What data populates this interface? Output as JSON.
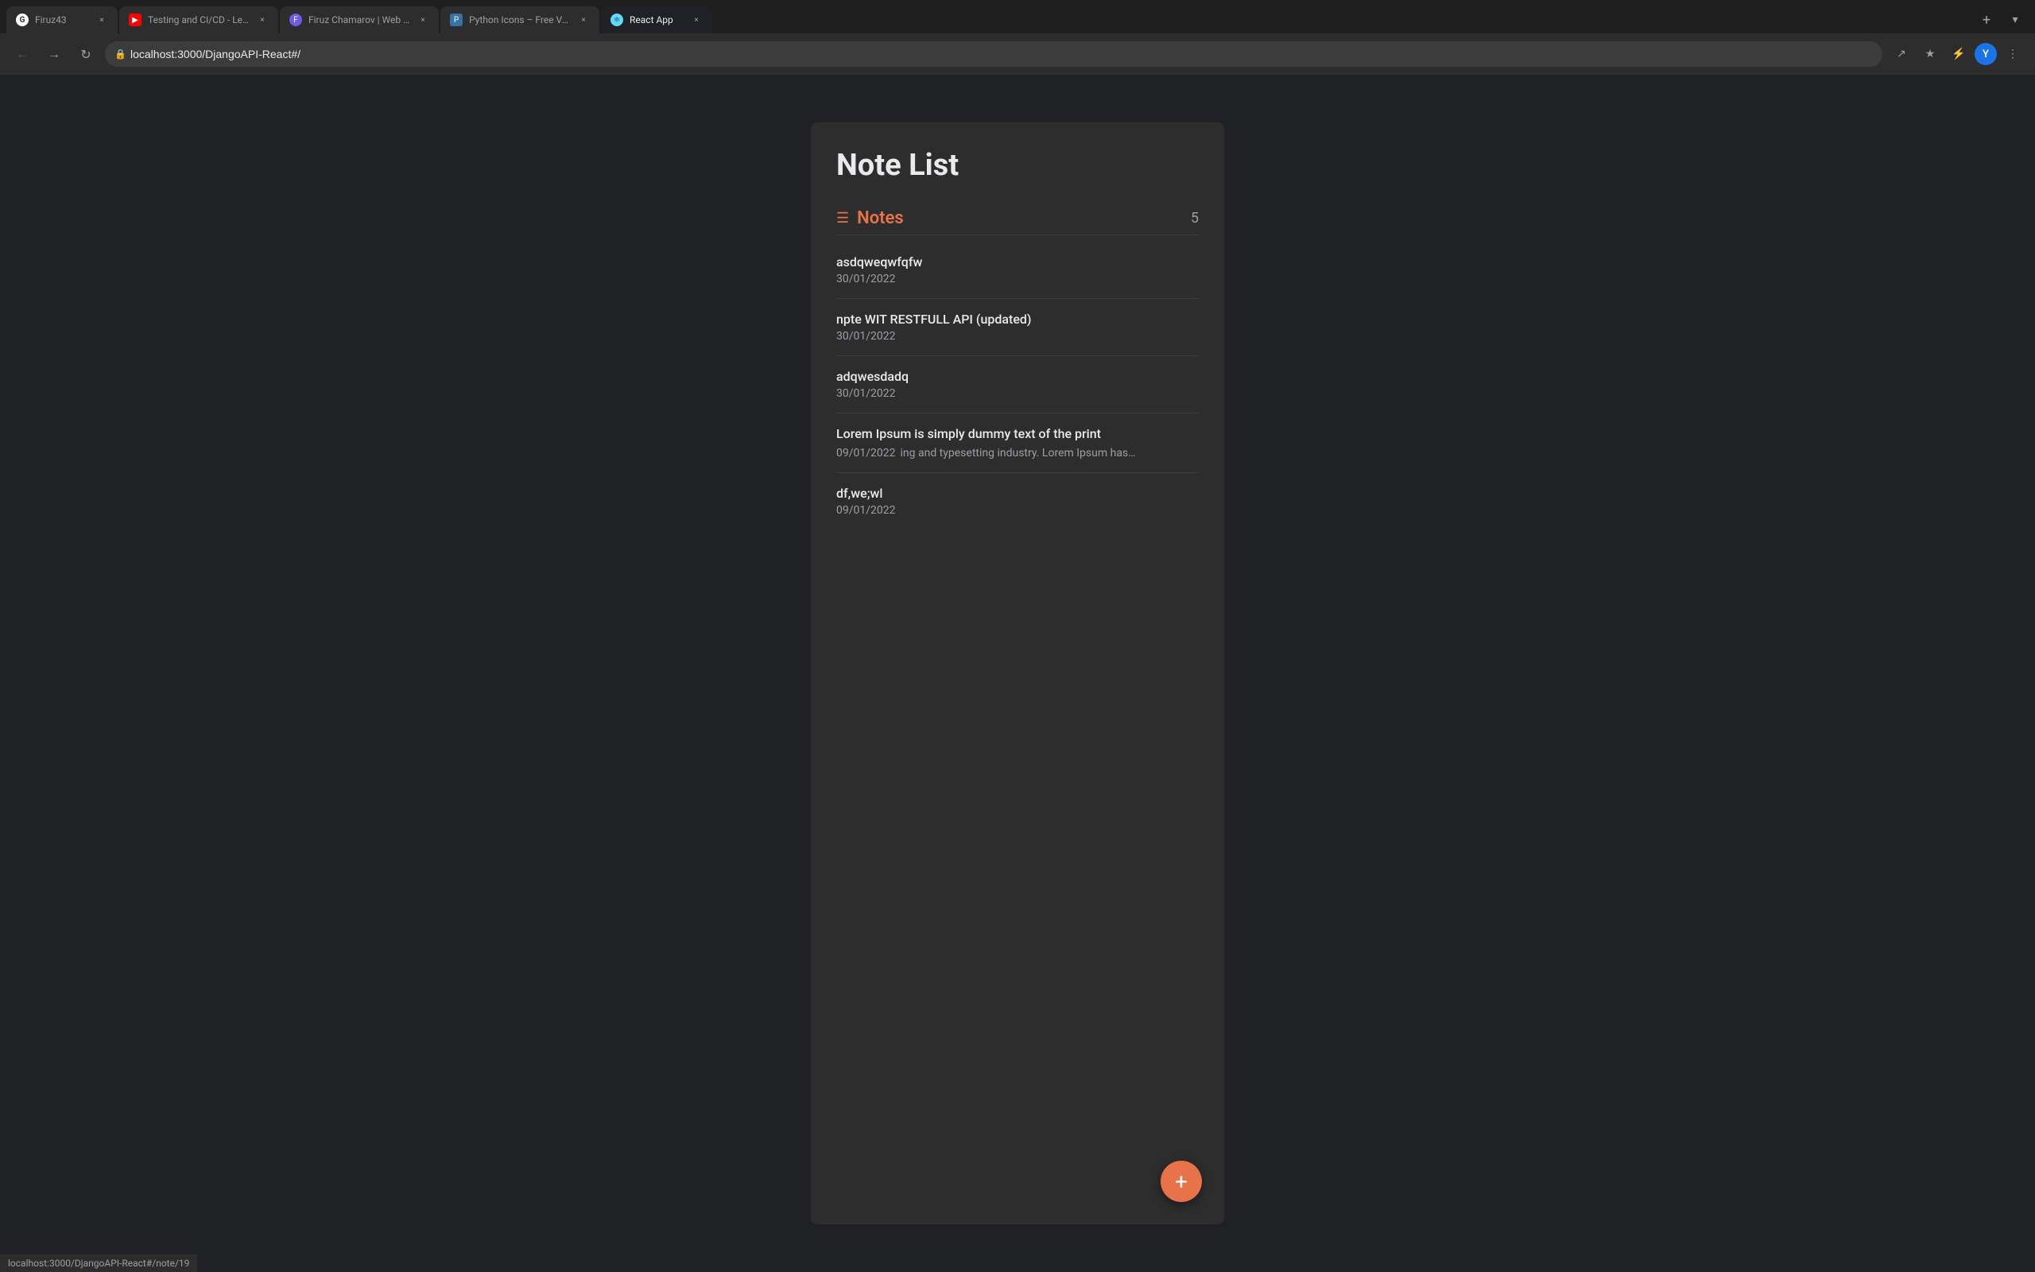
{
  "browser": {
    "tabs": [
      {
        "id": "tab-github",
        "title": "Firuz43",
        "favicon_type": "github",
        "favicon_char": "G",
        "active": false
      },
      {
        "id": "tab-youtube",
        "title": "Testing and CI/CD - Lecture",
        "favicon_type": "youtube",
        "favicon_char": "▶",
        "active": false
      },
      {
        "id": "tab-firuz",
        "title": "Firuz Chamarov | Web Devel…",
        "favicon_type": "firuz",
        "favicon_char": "F",
        "active": false
      },
      {
        "id": "tab-python",
        "title": "Python Icons – Free Vector I…",
        "favicon_type": "python",
        "favicon_char": "P",
        "active": false
      },
      {
        "id": "tab-react",
        "title": "React App",
        "favicon_type": "react",
        "favicon_char": "⚛",
        "active": true
      }
    ],
    "address": "localhost:3000/DjangoAPI-React#/",
    "status_url": "localhost:3000/DjangoAPI-React#/note/19"
  },
  "page": {
    "title": "Note List",
    "notes_label": "Notes",
    "notes_count": "5",
    "notes": [
      {
        "id": 1,
        "title": "asdqweqwfqfw",
        "date": "30/01/2022",
        "preview": ""
      },
      {
        "id": 2,
        "title": "npte WIT RESTFULL API (updated)",
        "date": "30/01/2022",
        "preview": ""
      },
      {
        "id": 3,
        "title": "adqwesdadq",
        "date": "30/01/2022",
        "preview": ""
      },
      {
        "id": 4,
        "title": "Lorem Ipsum is simply dummy text of the print",
        "date": "09/01/2022",
        "preview": "ing and typesetting industry. Lorem Ipsum has…"
      },
      {
        "id": 5,
        "title": "df,we;wl",
        "date": "09/01/2022",
        "preview": ""
      }
    ],
    "add_button_label": "+"
  },
  "colors": {
    "accent": "#e8734a",
    "bg": "#202124",
    "card_bg": "#2d2d2d",
    "text_primary": "#e8eaed",
    "text_muted": "#9aa0a6"
  }
}
